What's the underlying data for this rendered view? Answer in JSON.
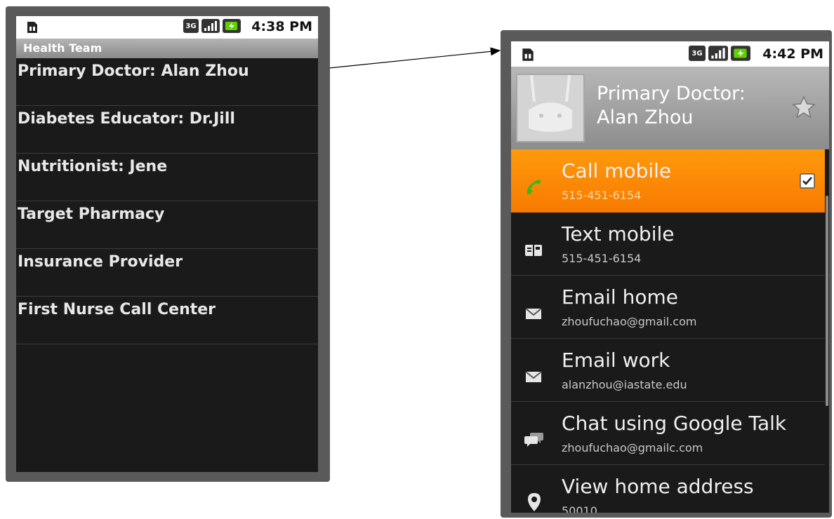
{
  "left_phone": {
    "status": {
      "time": "4:38 PM",
      "network": "3G"
    },
    "title": "Health Team",
    "items": [
      {
        "label": "Primary Doctor: Alan Zhou"
      },
      {
        "label": "Diabetes Educator: Dr.Jill"
      },
      {
        "label": "Nutritionist: Jene"
      },
      {
        "label": "Target Pharmacy"
      },
      {
        "label": "Insurance Provider"
      },
      {
        "label": "First Nurse Call Center"
      }
    ]
  },
  "right_phone": {
    "status": {
      "time": "4:42 PM",
      "network": "3G"
    },
    "contact": {
      "name": "Primary Doctor: Alan Zhou",
      "favorite": false
    },
    "actions": [
      {
        "label": "Call mobile",
        "sub": "515-451-6154",
        "icon": "phone-icon",
        "selected": true
      },
      {
        "label": "Text mobile",
        "sub": "515-451-6154",
        "icon": "sms-icon"
      },
      {
        "label": "Email home",
        "sub": "zhoufuchao@gmail.com",
        "icon": "envelope-icon"
      },
      {
        "label": "Email work",
        "sub": "alanzhou@iastate.edu",
        "icon": "envelope-icon"
      },
      {
        "label": "Chat using Google Talk",
        "sub": "zhoufuchao@gmailc.com",
        "icon": "chat-icon"
      },
      {
        "label": "View home address",
        "sub": "50010",
        "icon": "map-pin-icon"
      }
    ]
  },
  "colors": {
    "accent": "#f78500",
    "background": "#1a1a1a",
    "titlebar": "#9c9c9c"
  }
}
